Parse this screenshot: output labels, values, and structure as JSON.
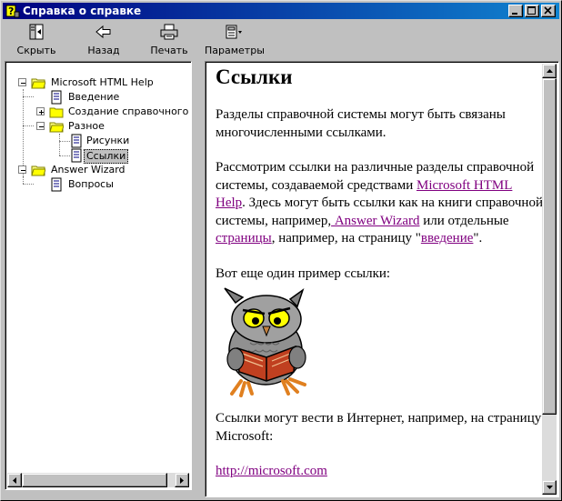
{
  "window": {
    "title": "Справка о справке",
    "minimize_icon": "minimize-icon",
    "maximize_icon": "maximize-icon",
    "close_icon": "close-icon"
  },
  "toolbar": {
    "hide_label": "Скрыть",
    "back_label": "Назад",
    "print_label": "Печать",
    "options_label": "Параметры"
  },
  "tree": {
    "items": [
      {
        "label": "Microsoft HTML Help",
        "icon": "open-book-icon"
      },
      {
        "label": "Введение",
        "icon": "page-icon"
      },
      {
        "label": "Создание справочного рук",
        "icon": "closed-book-icon"
      },
      {
        "label": "Разное",
        "icon": "open-book-icon"
      },
      {
        "label": "Рисунки",
        "icon": "page-icon"
      },
      {
        "label": "Ссылки",
        "icon": "page-icon",
        "selected": true
      },
      {
        "label": "Answer Wizard",
        "icon": "open-book-icon"
      },
      {
        "label": "Вопросы",
        "icon": "page-icon"
      }
    ]
  },
  "content": {
    "heading": "Ссылки",
    "p1": "Разделы справочной системы могут быть связаны многочисленными ссылками.",
    "p2_a": "Рассмотрим ссылки на различные разделы справочной системы, создаваемой средствами ",
    "p2_link1": "Microsoft HTML Help",
    "p2_b": ".  Здесь могут быть ссылки как на книги справочной системы, например,",
    "p2_link2": " Answer Wizard",
    "p2_c": " или отдельные ",
    "p2_link3": "страницы",
    "p2_d": ", например, на страницу \"",
    "p2_link4": "введение",
    "p2_e": "\".",
    "p3": "Вот еще один пример ссылки:",
    "image_icon": "owl-reading-book-image",
    "p4": "Ссылки могут вести в Интернет, например, на страницу Microsoft:",
    "url": "http://microsoft.com"
  },
  "colors": {
    "titlebar_start": "#000080",
    "titlebar_end": "#1084d0",
    "link": "#800080",
    "face": "#c0c0c0"
  }
}
